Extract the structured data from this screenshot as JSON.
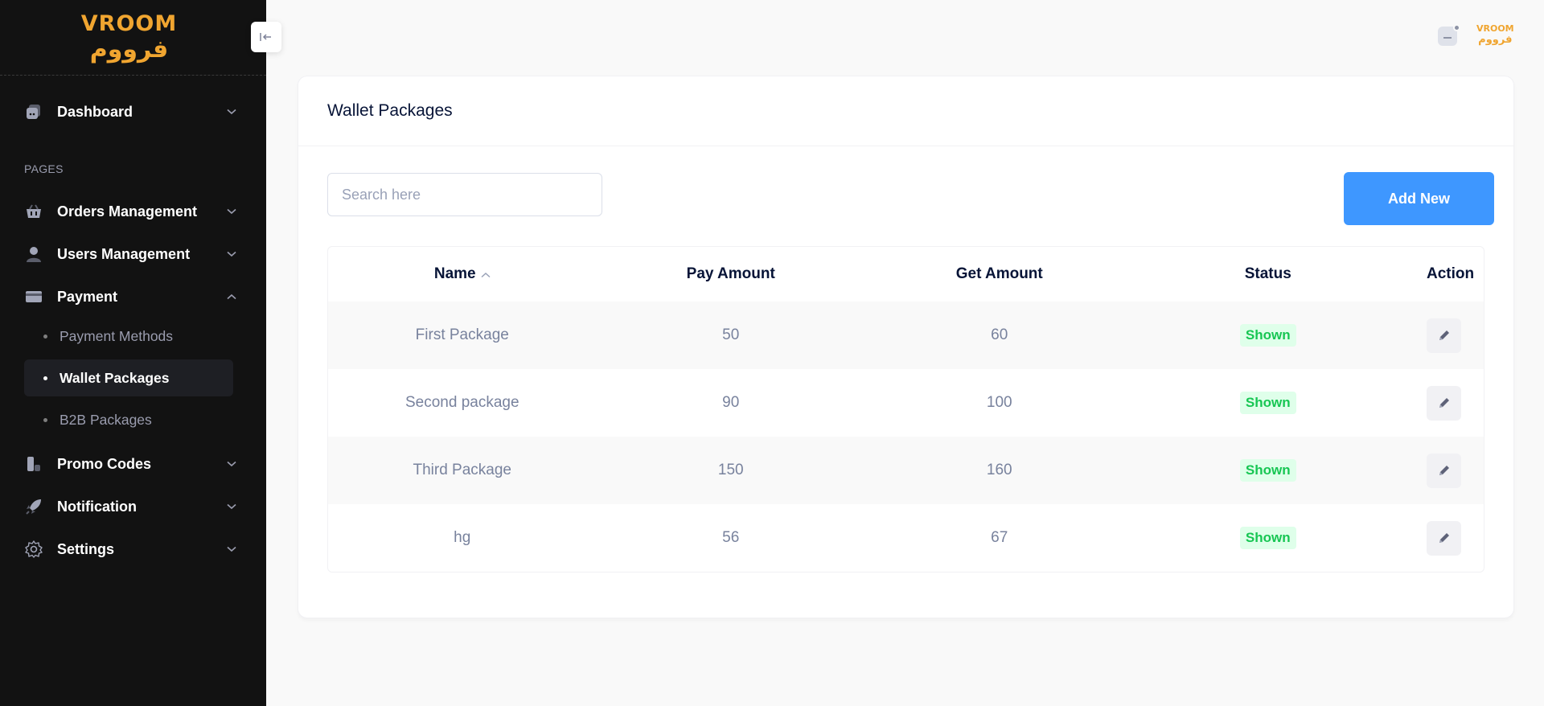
{
  "brand": {
    "name_en": "VROOM",
    "name_ar": "فرووم"
  },
  "sidebar": {
    "section_label": "PAGES",
    "dashboard": {
      "label": "Dashboard"
    },
    "items": [
      {
        "label": "Orders Management"
      },
      {
        "label": "Users Management"
      },
      {
        "label": "Payment"
      },
      {
        "label": "Promo Codes"
      },
      {
        "label": "Notification"
      },
      {
        "label": "Settings"
      }
    ],
    "payment_sub": [
      {
        "label": "Payment Methods"
      },
      {
        "label": "Wallet Packages"
      },
      {
        "label": "B2B Packages"
      }
    ]
  },
  "page": {
    "title": "Wallet Packages",
    "search": {
      "placeholder": "Search here",
      "value": ""
    },
    "add_button": "Add New"
  },
  "table": {
    "headers": {
      "name": "Name",
      "pay": "Pay Amount",
      "get": "Get Amount",
      "status": "Status",
      "action": "Action"
    },
    "rows": [
      {
        "name": "First Package",
        "pay": "50",
        "get": "60",
        "status": "Shown"
      },
      {
        "name": "Second package",
        "pay": "90",
        "get": "100",
        "status": "Shown"
      },
      {
        "name": "Third Package",
        "pay": "150",
        "get": "160",
        "status": "Shown"
      },
      {
        "name": "hg",
        "pay": "56",
        "get": "67",
        "status": "Shown"
      }
    ]
  },
  "colors": {
    "accent": "#3e97ff",
    "brand": "#f0a530",
    "sidebar_bg": "#121212",
    "status_green": "#17c653"
  }
}
